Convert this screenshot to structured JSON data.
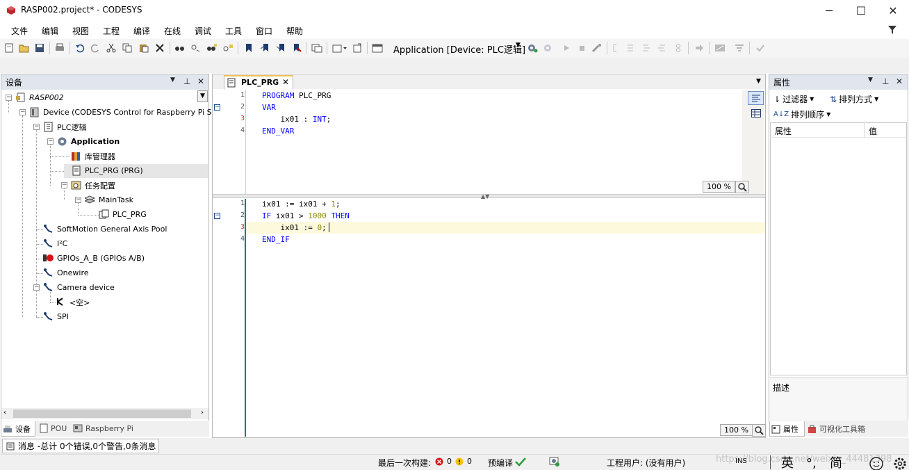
{
  "window": {
    "title": "RASP002.project* - CODESYS",
    "minimize": "─",
    "maximize": "☐",
    "close": "✕"
  },
  "menu": [
    "文件",
    "编辑",
    "视图",
    "工程",
    "编译",
    "在线",
    "调试",
    "工具",
    "窗口",
    "帮助"
  ],
  "toolbar": {
    "application_selector": "Application [Device: PLC逻辑]"
  },
  "devices_pane": {
    "title": "设备",
    "tree": [
      {
        "label": "RASP002",
        "italic": true
      },
      {
        "label": "Device (CODESYS Control for Raspberry Pi SL)"
      },
      {
        "label": "PLC逻辑"
      },
      {
        "label": "Application",
        "bold": true
      },
      {
        "label": "库管理器"
      },
      {
        "label": "PLC_PRG (PRG)",
        "selected": true
      },
      {
        "label": "任务配置"
      },
      {
        "label": "MainTask"
      },
      {
        "label": "PLC_PRG"
      },
      {
        "label": "SoftMotion General Axis Pool"
      },
      {
        "label": "I²C"
      },
      {
        "label": "GPIOs_A_B (GPIOs A/B)"
      },
      {
        "label": "Onewire"
      },
      {
        "label": "Camera device"
      },
      {
        "label": "<空>"
      },
      {
        "label": "SPI"
      }
    ],
    "bottom_tabs": [
      "设备",
      "POU",
      "Raspberry Pi"
    ]
  },
  "editor": {
    "tab_label": "PLC_PRG",
    "decl": {
      "line_numbers": [
        "1",
        "2",
        "3",
        "4"
      ],
      "lines": [
        [
          {
            "t": "PROGRAM",
            "k": "kw"
          },
          {
            "t": " PLC_PRG",
            "k": "id"
          }
        ],
        [
          {
            "t": "VAR",
            "k": "kw"
          }
        ],
        [
          {
            "t": "    ix01 : ",
            "k": "id"
          },
          {
            "t": "INT",
            "k": "kw"
          },
          {
            "t": ";",
            "k": "id"
          }
        ],
        [
          {
            "t": "END_VAR",
            "k": "kw"
          }
        ]
      ],
      "zoom": "100 %"
    },
    "impl": {
      "line_numbers": [
        "1",
        "2",
        "3",
        "4"
      ],
      "lines": [
        [
          {
            "t": "ix01 := ix01 + ",
            "k": "id"
          },
          {
            "t": "1",
            "k": "num"
          },
          {
            "t": ";",
            "k": "id"
          }
        ],
        [
          {
            "t": "IF",
            "k": "kw"
          },
          {
            "t": " ix01 > ",
            "k": "id"
          },
          {
            "t": "1000",
            "k": "num"
          },
          {
            "t": " ",
            "k": "id"
          },
          {
            "t": "THEN",
            "k": "kwb"
          }
        ],
        [
          {
            "t": "    ix01 := ",
            "k": "id"
          },
          {
            "t": "0",
            "k": "num"
          },
          {
            "t": ";",
            "k": "id"
          }
        ],
        [
          {
            "t": "END_IF",
            "k": "kw"
          }
        ]
      ],
      "zoom": "100 %"
    }
  },
  "properties_pane": {
    "title": "属性",
    "filter": "过滤器",
    "sort_by": "排列方式",
    "sort_order": "排列顺序",
    "col_property": "属性",
    "col_value": "值",
    "description": "描述",
    "bottom_tabs": [
      "属性",
      "可视化工具箱"
    ]
  },
  "messages_tab": "消息 -总计 0个错误,0个警告,0条消息",
  "status": {
    "last_build": "最后一次构建:",
    "errors": "0",
    "warnings": "0",
    "precompile": "预编译",
    "user": "工程用户: (没有用户)",
    "ins": "INS",
    "watermark": "https://blog.csdn.net/weixin_44481398",
    "ime": [
      "英",
      "°,",
      "简"
    ]
  },
  "colors": {
    "accent": "#1e4b8e",
    "selection": "#e6e6e6",
    "keyword": "#0000ff",
    "number": "#8b8b00"
  }
}
